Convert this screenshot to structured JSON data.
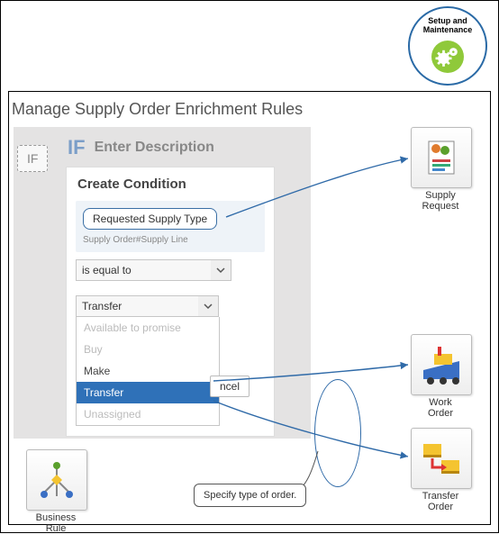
{
  "badge": {
    "line1": "Setup and",
    "line2": "Maintenance"
  },
  "page_title": "Manage Supply Order Enrichment Rules",
  "if_chip": "IF",
  "if_header_big": "IF",
  "if_header_desc": "Enter Description",
  "popup": {
    "title": "Create Condition",
    "attribute": "Requested Supply Type",
    "breadcrumb": "Supply Order#Supply Line",
    "operator": "is equal to",
    "value_selected": "Transfer",
    "options": {
      "atp": {
        "label": "Available to promise",
        "state": "disabled"
      },
      "buy": {
        "label": "Buy",
        "state": "disabled"
      },
      "make": {
        "label": "Make",
        "state": "enabled"
      },
      "transfer": {
        "label": "Transfer",
        "state": "highlight"
      },
      "unasg": {
        "label": "Unassigned",
        "state": "disabled"
      }
    },
    "cancel": "ncel"
  },
  "tiles": {
    "supply": {
      "label": "Supply\nRequest"
    },
    "work": {
      "label": "Work\nOrder"
    },
    "transfer": {
      "label": "Transfer\nOrder"
    },
    "biz": {
      "label": "Business\nRule"
    }
  },
  "callout": "Specify type of order."
}
